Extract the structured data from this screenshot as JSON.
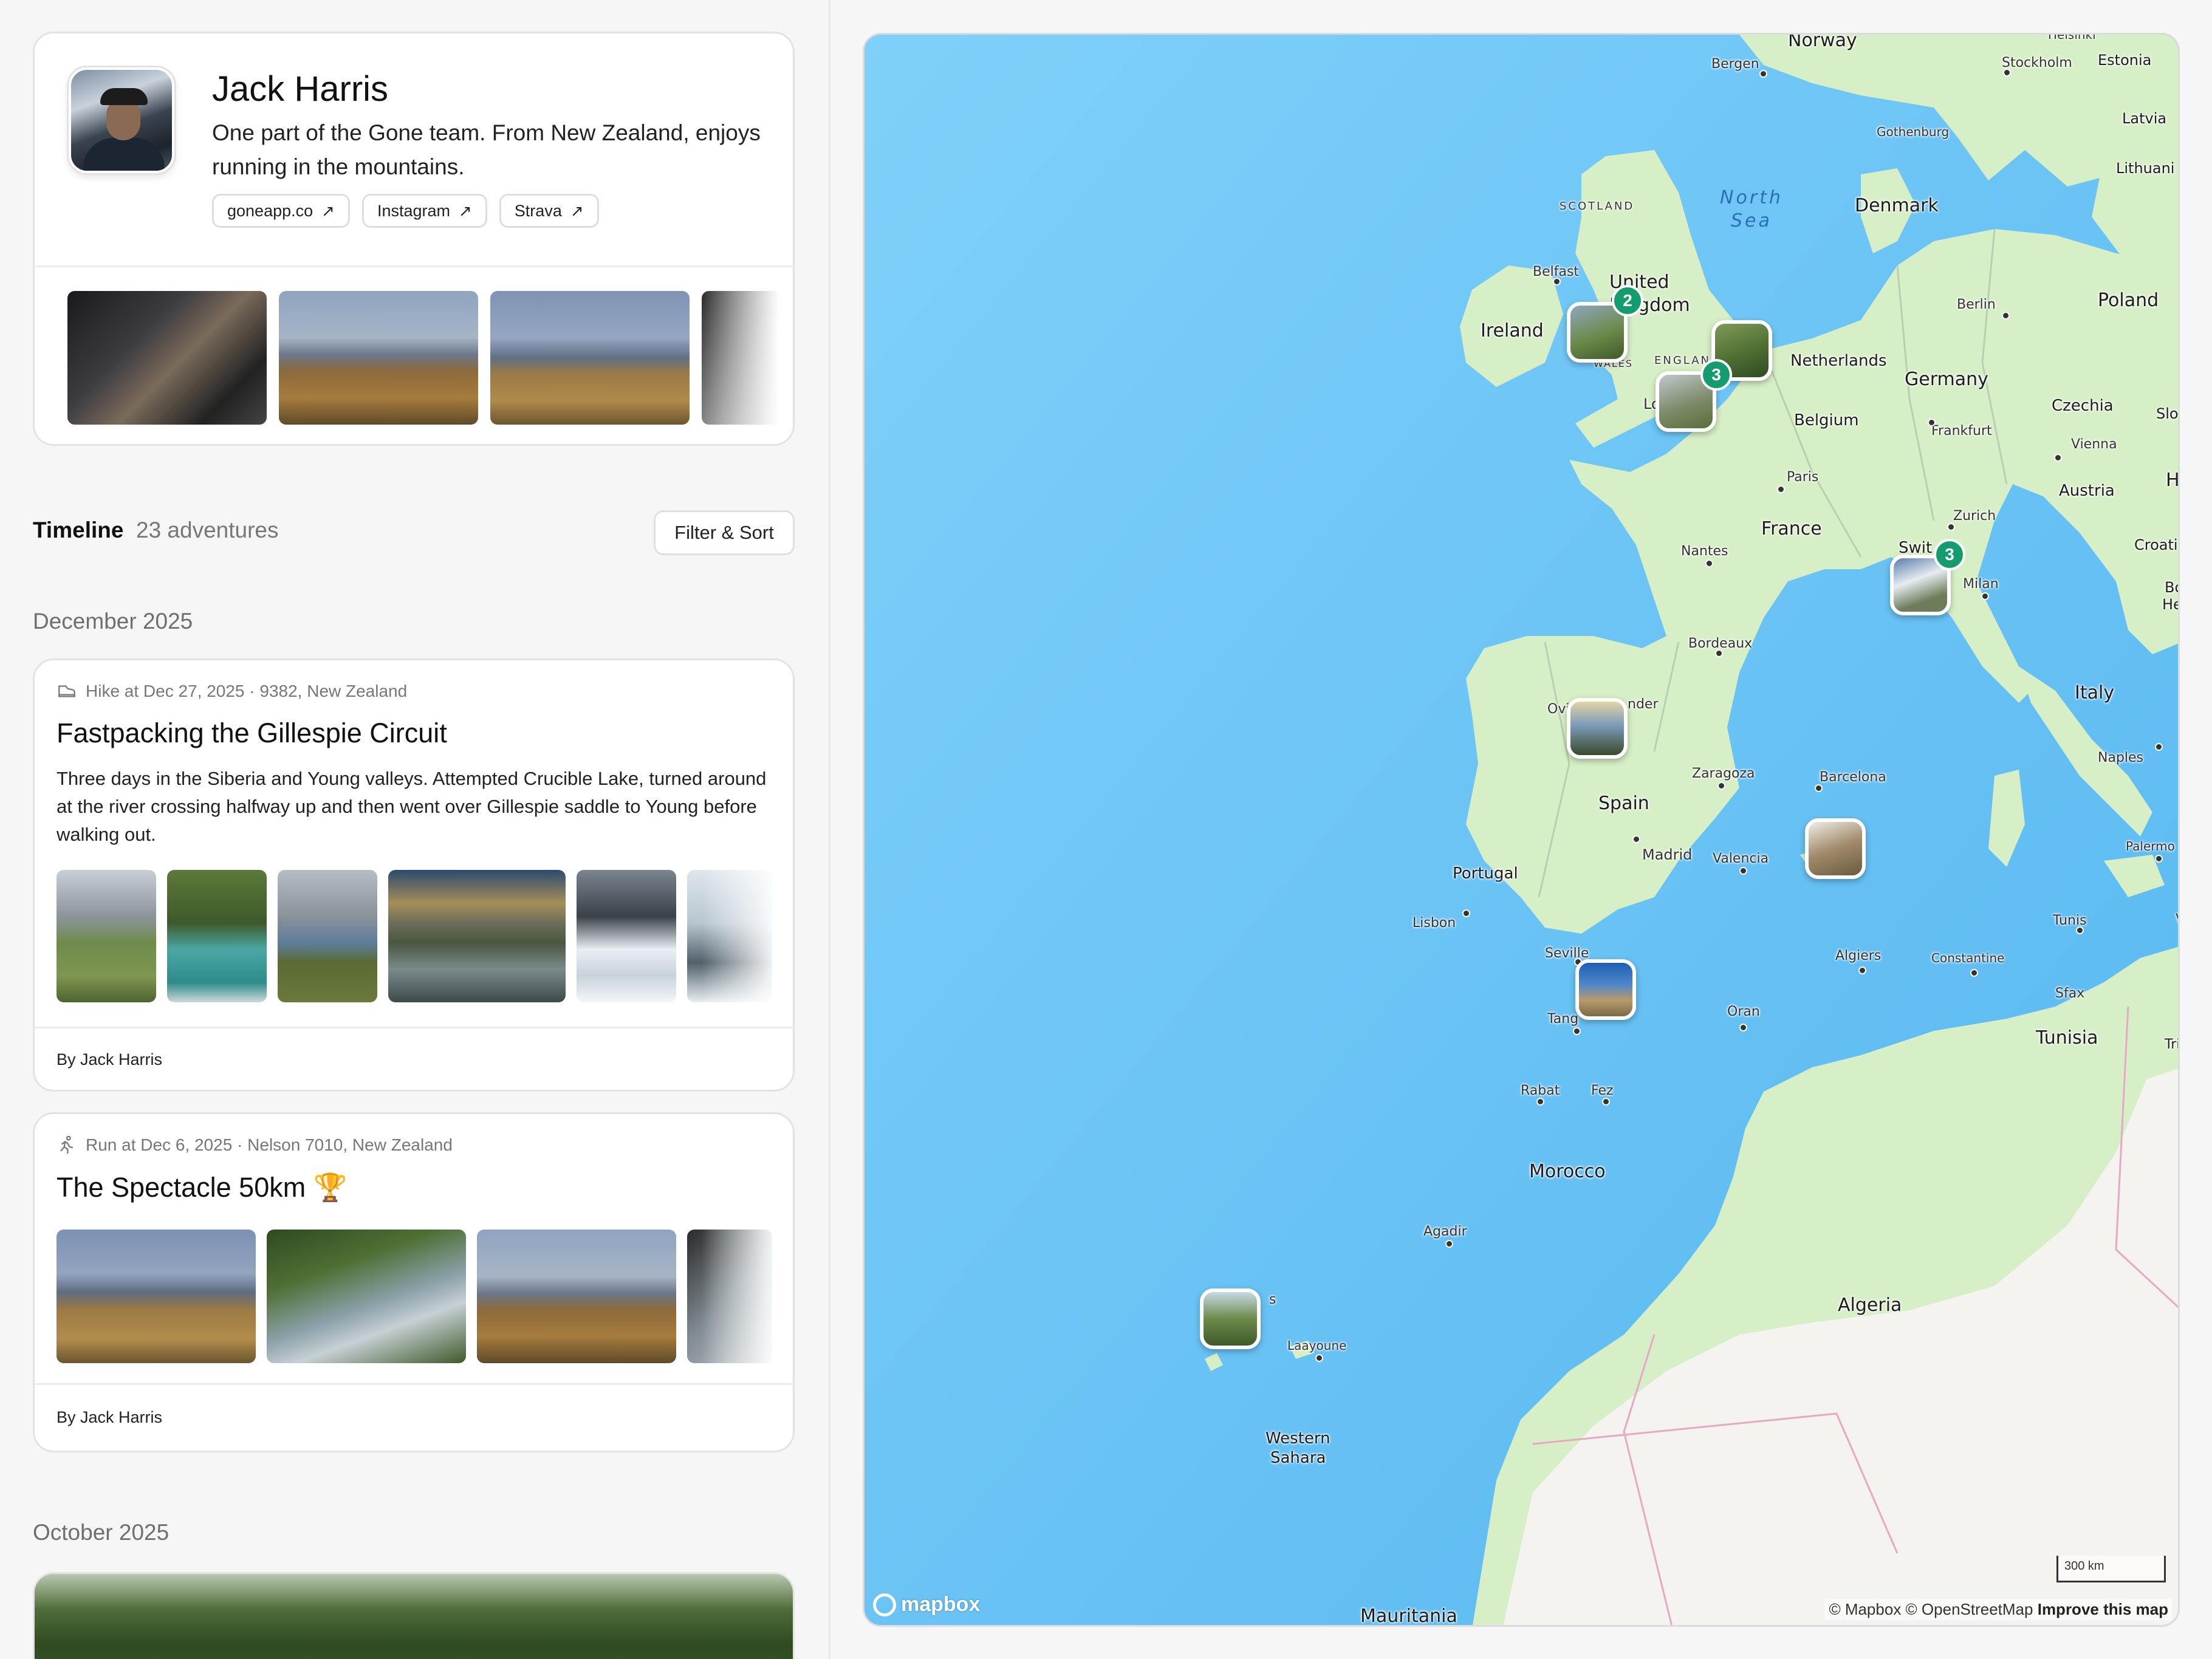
{
  "profile": {
    "name": "Jack Harris",
    "bio": "One part of the Gone team. From New Zealand, enjoys running in the mountains.",
    "links": [
      {
        "label": "goneapp.co",
        "icon": "arrow-up-right-icon"
      },
      {
        "label": "Instagram",
        "icon": "arrow-up-right-icon"
      },
      {
        "label": "Strava",
        "icon": "arrow-up-right-icon"
      }
    ]
  },
  "timeline": {
    "title": "Timeline",
    "count": "23 adventures",
    "filter_label": "Filter & Sort"
  },
  "months": [
    "December 2025",
    "October 2025"
  ],
  "adventures": [
    {
      "meta": "Hike at Dec 27, 2025 · 9382, New Zealand",
      "icon": "hike-boot-icon",
      "title": "Fastpacking the Gillespie Circuit",
      "description": "Three days in the Siberia and Young valleys. Attempted Crucible Lake, turned around at the river crossing halfway up and then went over Gillespie saddle to Young before walking out.",
      "author": "By Jack Harris"
    },
    {
      "meta": "Run at Dec 6, 2025 · Nelson 7010, New Zealand",
      "icon": "runner-icon",
      "title": "The Spectacle 50km 🏆",
      "author": "By Jack Harris"
    }
  ],
  "map": {
    "countries": [
      "Norway",
      "Estonia",
      "Latvia",
      "Lithuani",
      "Denmark",
      "Poland",
      "Ireland",
      "United",
      "Kingdom",
      "Netherlands",
      "Germany",
      "Belgium",
      "Czechia",
      "Slov",
      "Austria",
      "H",
      "France",
      "Swit",
      "Italy",
      "Croati",
      "Bo",
      "He",
      "Spain",
      "Portugal",
      "Tunisia",
      "Morocco",
      "Algeria",
      "Western",
      "Sahara",
      "Mauritania",
      "Tri"
    ],
    "cities": [
      "Bergen",
      "Stockholm",
      "Gothenburg",
      "Belfast",
      "Berlin",
      "Frankfurt",
      "Vienna",
      "Paris",
      "Zurich",
      "Milan",
      "Nantes",
      "Bordeaux",
      "Ovi",
      "nder",
      "Zaragoza",
      "Barcelona",
      "Madrid",
      "Valencia",
      "Lisbon",
      "Seville",
      "Tang",
      "Rabat",
      "Fez",
      "Oran",
      "Algiers",
      "Constantine",
      "Tunis",
      "Sfax",
      "Naples",
      "Palermo",
      "Agadir",
      "Laayoune",
      "ENGLAND",
      "SCOTLAND",
      "WALES",
      "Lo",
      "V",
      "s",
      "Helsinki"
    ],
    "seas": [
      "North",
      "Sea"
    ],
    "cluster_counts": [
      "2",
      "3",
      "3"
    ],
    "scale": "300 km",
    "attribution": "© Mapbox © OpenStreetMap",
    "improve": "Improve this map",
    "logo": "mapbox",
    "colors": {
      "water": "#6cc5f5",
      "land": "#d7efc6",
      "desert": "#f5f5f1",
      "badge": "#149c6e"
    }
  }
}
